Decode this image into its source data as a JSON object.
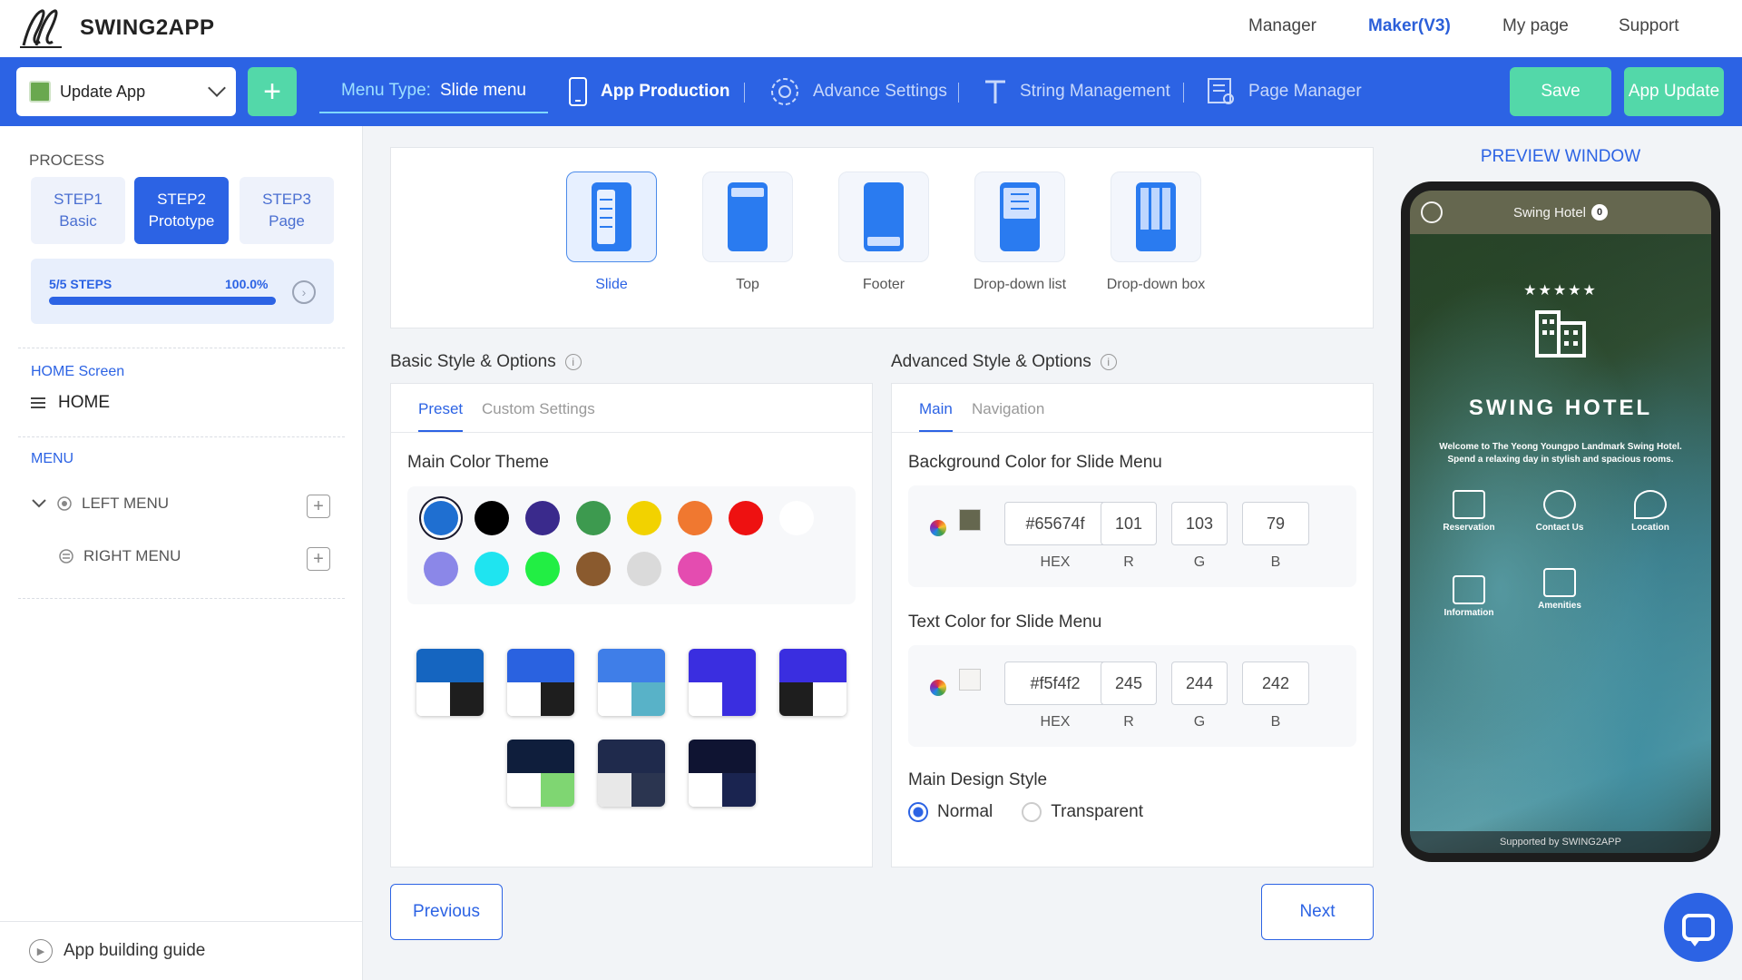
{
  "brand": {
    "name": "SWING2APP"
  },
  "topnav": [
    "Manager",
    "Maker(V3)",
    "My page",
    "Support"
  ],
  "toolbar": {
    "app_select": "Update App",
    "plus": "+",
    "menu_type_label": "Menu Type:",
    "menu_type_value": "Slide menu",
    "items": [
      "App Production",
      "Advance Settings",
      "String Management",
      "Page Manager"
    ],
    "save": "Save",
    "app_update": "App Update"
  },
  "sidebar": {
    "process_title": "PROCESS",
    "steps": [
      {
        "title": "STEP1",
        "sub": "Basic"
      },
      {
        "title": "STEP2",
        "sub": "Prototype"
      },
      {
        "title": "STEP3",
        "sub": "Page"
      }
    ],
    "progress": {
      "steps_text": "5/5 STEPS",
      "percent_text": "100.0%",
      "fraction": 1.0
    },
    "home_screen_label": "HOME Screen",
    "home_item": "HOME",
    "menu_label": "MENU",
    "menus": [
      "LEFT MENU",
      "RIGHT MENU"
    ],
    "guide": "App building guide"
  },
  "menu_types": {
    "items": [
      "Slide",
      "Top",
      "Footer",
      "Drop-down list",
      "Drop-down box"
    ],
    "selected": "Slide"
  },
  "basic": {
    "title": "Basic Style & Options",
    "tabs": [
      "Preset",
      "Custom Settings"
    ],
    "color_theme_label": "Main Color Theme",
    "colors": [
      "#1f6fd1",
      "#000000",
      "#3a2a8c",
      "#3d9a4f",
      "#f2d200",
      "#f07830",
      "#ee1111",
      "#ffffff",
      "#8b87e8",
      "#1fe4f0",
      "#22ee44",
      "#8a5a2e",
      "#dadada",
      "#e44cb0"
    ],
    "themes": [
      {
        "top": "#1565c0",
        "bl": "#ffffff",
        "br": "#1e1e1e"
      },
      {
        "top": "#2a62e0",
        "bl": "#ffffff",
        "br": "#1e1e1e"
      },
      {
        "top": "#3f7ee8",
        "bl": "#ffffff",
        "br": "#58b2c8"
      },
      {
        "top": "#3a2ee0",
        "bl": "#ffffff",
        "br": "#3a2ee0"
      },
      {
        "top": "#3a2ee0",
        "bl": "#1e1e1e",
        "br": "#ffffff"
      },
      {
        "top": "#0f1e3c",
        "bl": "#ffffff",
        "br": "#7fd672"
      },
      {
        "top": "#1f2a4c",
        "bl": "#e8e8e8",
        "br": "#2b3550"
      },
      {
        "top": "#0f1432",
        "bl": "#ffffff",
        "br": "#1a2450"
      }
    ]
  },
  "advanced": {
    "title": "Advanced Style & Options",
    "tabs": [
      "Main",
      "Navigation"
    ],
    "bg_label": "Background Color for Slide Menu",
    "bg": {
      "hex": "#65674f",
      "r": "101",
      "g": "103",
      "b": "79"
    },
    "text_label": "Text Color for Slide Menu",
    "text": {
      "hex": "#f5f4f2",
      "r": "245",
      "g": "244",
      "b": "242"
    },
    "field_labels": {
      "hex": "HEX",
      "r": "R",
      "g": "G",
      "b": "B"
    },
    "design_label": "Main Design Style",
    "design_options": [
      "Normal",
      "Transparent"
    ],
    "design_selected": "Normal"
  },
  "buttons": {
    "previous": "Previous",
    "next": "Next"
  },
  "preview": {
    "title": "PREVIEW WINDOW",
    "header": "Swing Hotel",
    "badge": "0",
    "stars": "★★★★★",
    "hotel_name": "SWING HOTEL",
    "hotel_sub": "Welcome to The Yeong Youngpo Landmark Swing Hotel. Spend a relaxing day in stylish and spacious rooms.",
    "icons": [
      "Reservation",
      "Contact Us",
      "Location",
      "Information",
      "Amenities"
    ],
    "footer": "Supported by SWING2APP"
  }
}
